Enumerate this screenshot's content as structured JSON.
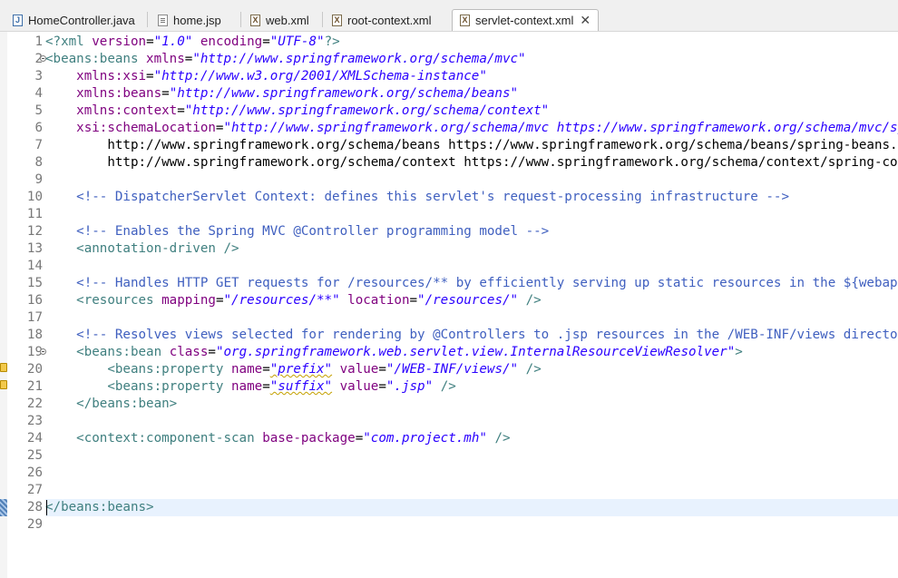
{
  "tabs": [
    {
      "label": "HomeController.java",
      "icon": "java-file-icon",
      "active": false
    },
    {
      "label": "home.jsp",
      "icon": "jsp-file-icon",
      "active": false
    },
    {
      "label": "web.xml",
      "icon": "xml-file-icon",
      "active": false
    },
    {
      "label": "root-context.xml",
      "icon": "xml-file-icon",
      "active": false
    },
    {
      "label": "servlet-context.xml",
      "icon": "xml-file-icon",
      "active": true
    }
  ],
  "close_glyph": "✕",
  "editor": {
    "line_numbers": [
      "1",
      "2",
      "3",
      "4",
      "5",
      "6",
      "7",
      "8",
      "9",
      "10",
      "11",
      "12",
      "13",
      "14",
      "15",
      "16",
      "17",
      "18",
      "19",
      "20",
      "21",
      "22",
      "23",
      "24",
      "25",
      "26",
      "27",
      "28",
      "29"
    ],
    "lines": [
      "<?xml version=\"1.0\" encoding=\"UTF-8\"?>",
      "<beans:beans xmlns=\"http://www.springframework.org/schema/mvc\"",
      "    xmlns:xsi=\"http://www.w3.org/2001/XMLSchema-instance\"",
      "    xmlns:beans=\"http://www.springframework.org/schema/beans\"",
      "    xmlns:context=\"http://www.springframework.org/schema/context\"",
      "    xsi:schemaLocation=\"http://www.springframework.org/schema/mvc https://www.springframework.org/schema/mvc/spring-mvc.xsd",
      "        http://www.springframework.org/schema/beans https://www.springframework.org/schema/beans/spring-beans.xsd",
      "        http://www.springframework.org/schema/context https://www.springframework.org/schema/context/spring-context.xsd\">",
      "",
      "    <!-- DispatcherServlet Context: defines this servlet's request-processing infrastructure -->",
      "",
      "    <!-- Enables the Spring MVC @Controller programming model -->",
      "    <annotation-driven />",
      "",
      "    <!-- Handles HTTP GET requests for /resources/** by efficiently serving up static resources in the ${webappRoot}/resources directory -->",
      "    <resources mapping=\"/resources/**\" location=\"/resources/\" />",
      "",
      "    <!-- Resolves views selected for rendering by @Controllers to .jsp resources in the /WEB-INF/views directory -->",
      "    <beans:bean class=\"org.springframework.web.servlet.view.InternalResourceViewResolver\">",
      "        <beans:property name=\"prefix\" value=\"/WEB-INF/views/\" />",
      "        <beans:property name=\"suffix\" value=\".jsp\" />",
      "    </beans:bean>",
      "",
      "    <context:component-scan base-package=\"com.project.mh\" />",
      "",
      "",
      "",
      "</beans:beans>",
      ""
    ]
  }
}
